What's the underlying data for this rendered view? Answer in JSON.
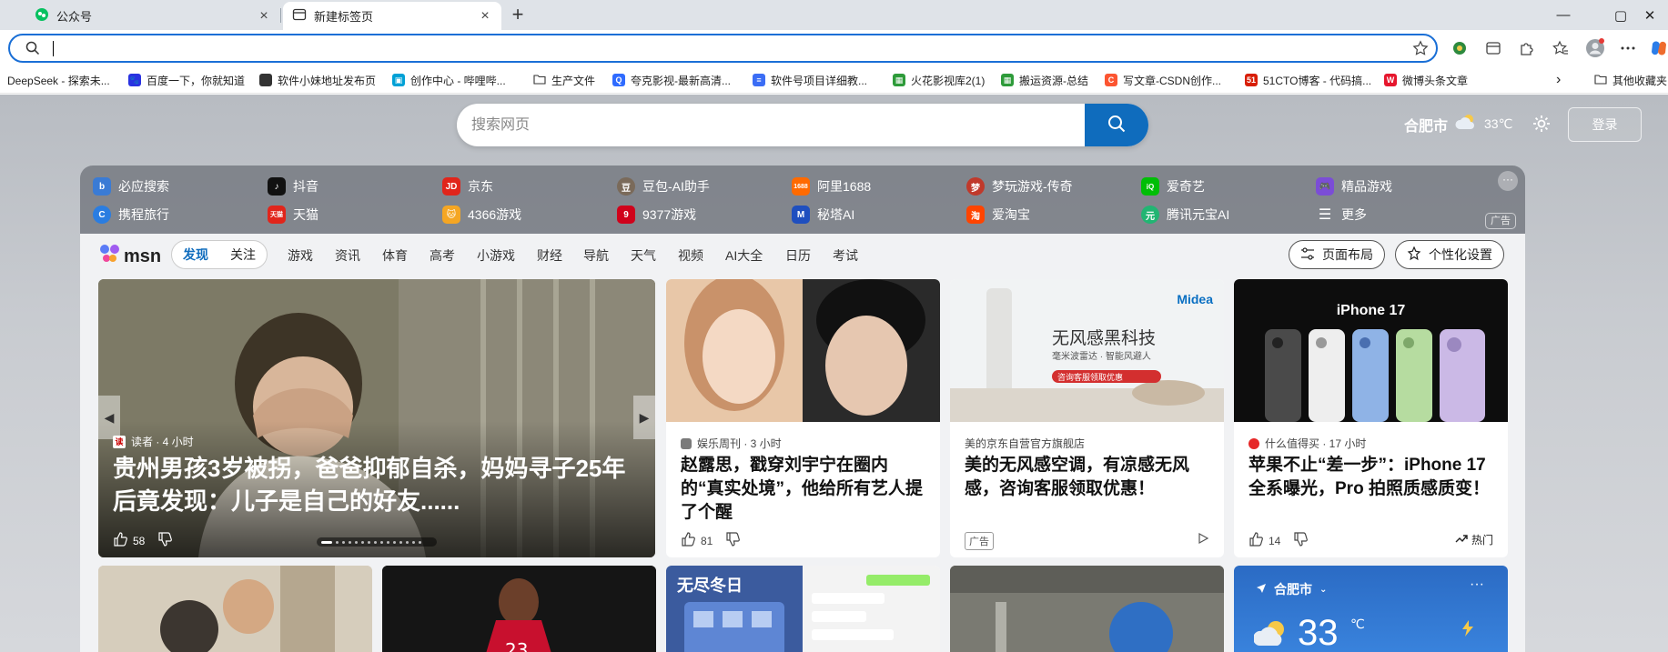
{
  "tabs": [
    {
      "title": "公众号",
      "close": "×"
    },
    {
      "title": "新建标签页",
      "close": "×"
    }
  ],
  "new_tab_symbol": "+",
  "window_controls": {
    "minimize": "—",
    "maximize": "▢",
    "close": "✕"
  },
  "favorites": [
    {
      "label": "DeepSeek - 探索未...",
      "color": "#4d6bfe"
    },
    {
      "label": "百度一下，你就知道",
      "color": "#2932e1"
    },
    {
      "label": "软件小妹地址发布页",
      "color": "#333333"
    },
    {
      "label": "创作中心 - 哔哩哔...",
      "color": "#00a1d6"
    },
    {
      "label": "生产文件",
      "color": "#666666"
    },
    {
      "label": "夸克影视-最新高清...",
      "color": "#2f6bff"
    },
    {
      "label": "软件号项目详细教...",
      "color": "#3b6df5"
    },
    {
      "label": "火花影视库2(1)",
      "color": "#2e9b3a"
    },
    {
      "label": "搬运资源-总结",
      "color": "#2e9b3a"
    },
    {
      "label": "写文章-CSDN创作...",
      "color": "#fc5531"
    },
    {
      "label": "51CTO博客 - 代码搞...",
      "color": "#d81e06"
    },
    {
      "label": "微博头条文章",
      "color": "#e6162d"
    }
  ],
  "favorites_more": "›",
  "other_favorites": "其他收藏夹",
  "search": {
    "placeholder": "搜索网页"
  },
  "weather": {
    "city": "合肥市",
    "temp": "33℃"
  },
  "login_label": "登录",
  "quick_links_row1": [
    {
      "label": "必应搜索",
      "color": "#3a7bd5",
      "glyph": "b"
    },
    {
      "label": "抖音",
      "color": "#111111",
      "glyph": "♪"
    },
    {
      "label": "京东",
      "color": "#e1251b",
      "glyph": "JD"
    },
    {
      "label": "豆包-AI助手",
      "color": "#7a6a5a",
      "glyph": "豆"
    },
    {
      "label": "阿里1688",
      "color": "#ff6a00",
      "glyph": "1688"
    },
    {
      "label": "梦玩游戏-传奇",
      "color": "#c0392b",
      "glyph": "梦"
    },
    {
      "label": "爱奇艺",
      "color": "#00be06",
      "glyph": "iQ"
    },
    {
      "label": "精品游戏",
      "color": "#7b4dd6",
      "glyph": "🎮"
    }
  ],
  "quick_links_row2": [
    {
      "label": "携程旅行",
      "color": "#2a7de1",
      "glyph": "C"
    },
    {
      "label": "天猫",
      "color": "#e1251b",
      "glyph": "天猫"
    },
    {
      "label": "4366游戏",
      "color": "#f5a623",
      "glyph": "🐱"
    },
    {
      "label": "9377游戏",
      "color": "#d0021b",
      "glyph": "9"
    },
    {
      "label": "秘塔AI",
      "color": "#1f4fbf",
      "glyph": "M"
    },
    {
      "label": "爱淘宝",
      "color": "#ff4400",
      "glyph": "淘"
    },
    {
      "label": "腾讯元宝AI",
      "color": "#22b573",
      "glyph": "元"
    },
    {
      "label": "更多",
      "color": "transparent",
      "glyph": "☰"
    }
  ],
  "quick_links_ad": "广告",
  "msn": {
    "logo": "msn",
    "seg": [
      "发现",
      "关注"
    ],
    "nav": [
      "游戏",
      "资讯",
      "体育",
      "高考",
      "小游戏",
      "财经",
      "导航",
      "天气",
      "视频",
      "AI大全",
      "日历",
      "考试"
    ],
    "layout_btn": "页面布局",
    "personalize_btn": "个性化设置"
  },
  "hero": {
    "source": "读者 · 4 小时",
    "headline": "贵州男孩3岁被拐，爸爸抑郁自杀，妈妈寻子25年后竟发现：儿子是自己的好友......",
    "likes": "58"
  },
  "cards": [
    {
      "meta": "娱乐周刊 · 3 小时",
      "title": "赵露思，戳穿刘宇宁在圈内的“真实处境”，他给所有艺人提了个醒",
      "likes": "81",
      "meta_color": "#7a7a7a"
    },
    {
      "meta": "美的京东自营官方旗舰店",
      "title": "美的无风感空调，有凉感无风感，咨询客服领取优惠！",
      "ad": "广告"
    },
    {
      "meta": "什么值得买 · 17 小时",
      "title": "苹果不止“差一步”：iPhone 17 全系曝光，Pro 拍照质感质变！",
      "likes": "14",
      "hot": "热门",
      "meta_color": "#e62828"
    }
  ],
  "ad_card": {
    "brand": "Midea",
    "headline": "无风感黑科技",
    "sub": "毫米波雷达 · 智能风避人",
    "cta": "咨询客服领取优惠"
  },
  "iphone_card": {
    "label": "iPhone 17"
  },
  "game_card": {
    "label": "无尽冬日"
  },
  "weather_card": {
    "city": "合肥市",
    "temp": "33",
    "unit": "℃"
  }
}
